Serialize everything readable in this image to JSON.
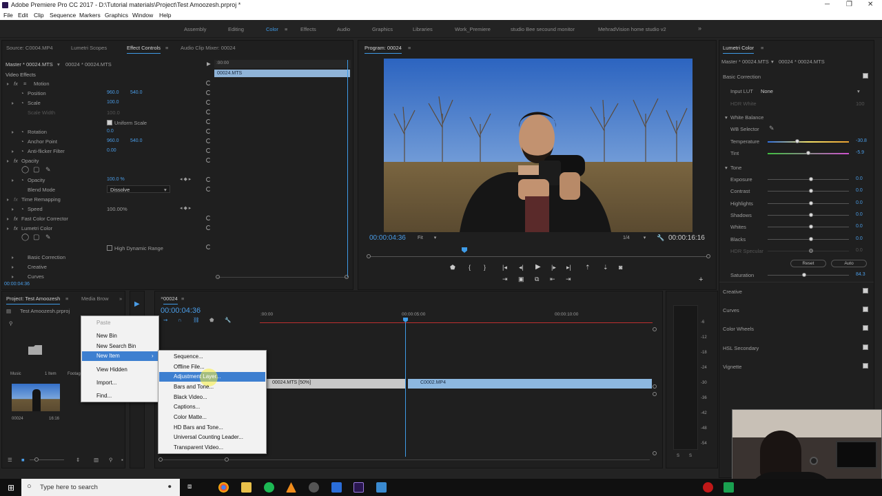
{
  "window": {
    "title": "Adobe Premiere Pro CC 2017 - D:\\Tutorial materials\\Project\\Test Amoozesh.prproj *"
  },
  "menu": [
    "File",
    "Edit",
    "Clip",
    "Sequence",
    "Markers",
    "Graphics",
    "Window",
    "Help"
  ],
  "workspaces": [
    "Assembly",
    "Editing",
    "Color",
    "Effects",
    "Audio",
    "Graphics",
    "Libraries",
    "Work_Premiere",
    "studio Bee secound monitor",
    "MehradVision home studio v2"
  ],
  "active_workspace": "Color",
  "left_tabs": [
    "Source: C0004.MP4",
    "Lumetri Scopes",
    "Effect Controls",
    "Audio Clip Mixer: 00024"
  ],
  "effect_controls": {
    "master": "Master * 00024.MTS",
    "clip": "00024 * 00024.MTS",
    "section": "Video Effects",
    "ruler": ":00:00",
    "clip_bar": "00024.MTS",
    "motion": "Motion",
    "position": {
      "label": "Position",
      "x": "960.0",
      "y": "540.0"
    },
    "scale": {
      "label": "Scale",
      "value": "100.0"
    },
    "scale_width": {
      "label": "Scale Width",
      "value": "100.0"
    },
    "uniform_scale": "Uniform Scale",
    "rotation": {
      "label": "Rotation",
      "value": "0.0"
    },
    "anchor": {
      "label": "Anchor Point",
      "x": "960.0",
      "y": "540.0"
    },
    "antiflicker": {
      "label": "Anti-flicker Filter",
      "value": "0.00"
    },
    "opacity_group": "Opacity",
    "opacity": {
      "label": "Opacity",
      "value": "100.0 %"
    },
    "blend": {
      "label": "Blend Mode",
      "value": "Dissolve"
    },
    "time_remap": "Time Remapping",
    "speed": {
      "label": "Speed",
      "value": "100.00%"
    },
    "fcc": "Fast Color Corrector",
    "lumetri": "Lumetri Color",
    "hdr": "High Dynamic Range",
    "basic": "Basic Correction",
    "creative": "Creative",
    "curves": "Curves",
    "timecode": "00:00:04:36"
  },
  "program": {
    "title": "Program: 00024",
    "timecode": "00:00:04:36",
    "fit": "Fit",
    "quality": "1/4",
    "duration": "00:00:16:16"
  },
  "lumetri": {
    "title": "Lumetri Color",
    "master": "Master * 00024.MTS",
    "clip": "00024 * 00024.MTS",
    "basic_correction": "Basic Correction",
    "input_lut_label": "Input LUT",
    "input_lut_value": "None",
    "hdr_white": "HDR White",
    "hdr_white_value": "100",
    "white_balance": "White Balance",
    "wb_selector": "WB Selector",
    "temperature": {
      "label": "Temperature",
      "value": "-30.8"
    },
    "tint": {
      "label": "Tint",
      "value": "-5.9"
    },
    "tone": "Tone",
    "tone_rows": [
      {
        "label": "Exposure",
        "value": "0.0"
      },
      {
        "label": "Contrast",
        "value": "0.0"
      },
      {
        "label": "Highlights",
        "value": "0.0"
      },
      {
        "label": "Shadows",
        "value": "0.0"
      },
      {
        "label": "Whites",
        "value": "0.0"
      },
      {
        "label": "Blacks",
        "value": "0.0"
      },
      {
        "label": "HDR Specular",
        "value": "0.0"
      }
    ],
    "reset": "Reset",
    "auto": "Auto",
    "saturation": {
      "label": "Saturation",
      "value": "84.3"
    },
    "sections": [
      "Creative",
      "Curves",
      "Color Wheels",
      "HSL Secondary",
      "Vignette"
    ]
  },
  "project": {
    "tabs": [
      "Project: Test Amoozesh",
      "Media Brow"
    ],
    "file": "Test Amoozesh.prproj",
    "bin_name": "Music",
    "bin_count": "1 Item",
    "footage_label": "Footage",
    "clip_name": "00024",
    "clip_duration": "16:16"
  },
  "context_menu": {
    "items": [
      "Paste",
      "New Bin",
      "New Search Bin",
      "New Item",
      "View Hidden",
      "Import...",
      "Find..."
    ],
    "highlighted": "New Item"
  },
  "submenu": {
    "items": [
      "Sequence...",
      "Offline File...",
      "Adjustment Layer...",
      "Bars and Tone...",
      "Black Video...",
      "Captions...",
      "Color Matte...",
      "HD Bars and Tone...",
      "Universal Counting Leader...",
      "Transparent Video..."
    ],
    "highlighted": "Adjustment Layer..."
  },
  "timeline": {
    "tab": "00024",
    "timecode": "00:00:04:36",
    "ruler": [
      ":00:00",
      "00:00:05:00",
      "00:00:10:00"
    ],
    "clip1": "00024.MTS [50%]",
    "clip2": "C0002.MP4",
    "meter_ticks": [
      "-6",
      "-12",
      "-18",
      "-24",
      "-30",
      "-36",
      "-42",
      "-48",
      "-54"
    ],
    "solo": [
      "S",
      "S"
    ]
  },
  "taskbar": {
    "search_placeholder": "Type here to search"
  }
}
